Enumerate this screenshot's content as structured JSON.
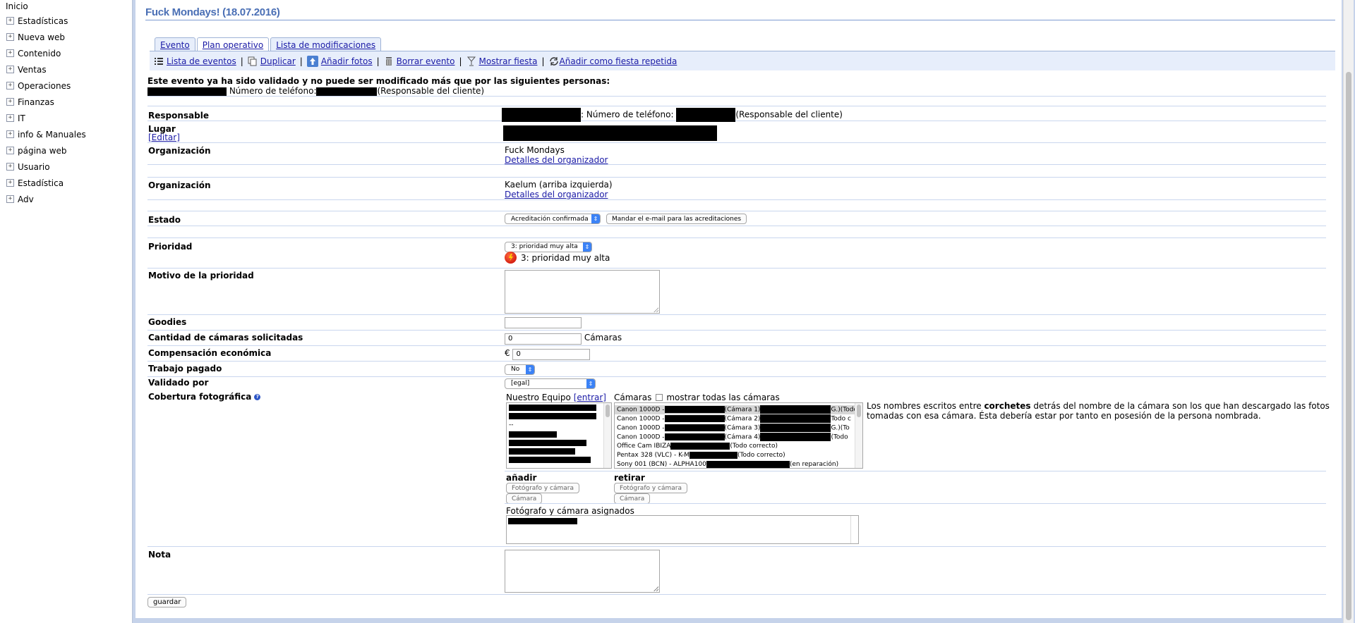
{
  "sidebar": {
    "home": "Inicio",
    "items": [
      "Estadísticas",
      "Nueva web",
      "Contenido",
      "Ventas",
      "Operaciones",
      "Finanzas",
      "IT",
      "info & Manuales",
      "página web",
      "Usuario",
      "Estadística",
      "Adv"
    ],
    "expander": "+"
  },
  "page": {
    "title": "Fuck Mondays! (18.07.2016)"
  },
  "tabs": [
    "Evento",
    "Plan operativo",
    "Lista de modificaciones"
  ],
  "actions": {
    "list": "Lista de eventos",
    "duplicate": "Duplicar",
    "add_photos": "Añadir fotos",
    "delete": "Borrar evento",
    "show": "Mostrar fiesta",
    "repeat": "Añadir como fiesta repetida",
    "separator": "|"
  },
  "notice": {
    "line1": "Este evento ya ha sido validado y no puede ser modificado más que por las siguientes personas:",
    "phone_label": "Número de teléfono:",
    "role": "(Responsable del cliente)"
  },
  "form": {
    "responsable": {
      "label": "Responsable",
      "phone_label": ": Número de teléfono:",
      "role": "(Responsable del cliente)"
    },
    "lugar": {
      "label": "Lugar",
      "edit": "[Editar]"
    },
    "org1": {
      "label": "Organización",
      "name": "Fuck Mondays",
      "link": "Detalles del organizador"
    },
    "org2": {
      "label": "Organización",
      "name": "Kaelum (arriba izquierda)",
      "link": "Detalles del organizador"
    },
    "estado": {
      "label": "Estado",
      "value": "Acreditación confirmada",
      "button": "Mandar el e-mail para las acreditaciones"
    },
    "prioridad": {
      "label": "Prioridad",
      "value": "3: prioridad muy alta",
      "display": "3: prioridad muy alta"
    },
    "motivo": {
      "label": "Motivo de la prioridad"
    },
    "goodies": {
      "label": "Goodies",
      "value": ""
    },
    "camaras": {
      "label": "Cantidad de cámaras solicitadas",
      "value": "0",
      "unit": "Cámaras"
    },
    "compensacion": {
      "label": "Compensación económica",
      "currency": "€",
      "value": "0"
    },
    "trabajo": {
      "label": "Trabajo pagado",
      "value": "No"
    },
    "validado": {
      "label": "Validado por",
      "value": "[egal]"
    },
    "cobertura": {
      "label": "Cobertura fotográfica",
      "team_label": "Nuestro Equipo",
      "team_link": "[entrar]",
      "team_dash": "--",
      "cams_label": "Cámaras",
      "show_all": "mostrar todas las cámaras",
      "cameras": [
        {
          "prefix": "Canon 1000D -",
          "mid": "(Cámara 1)",
          "suffix": "G.)(Todo c"
        },
        {
          "prefix": "Canon 1000D -",
          "mid": "(Cámara 2)",
          "suffix": "Todo c"
        },
        {
          "prefix": "Canon 1000D -",
          "mid": "(Cámara 3)",
          "suffix": "G.)(To"
        },
        {
          "prefix": "Canon 1000D -",
          "mid": "(Cámara 4)",
          "suffix": "(Todo"
        },
        {
          "prefix": "Office Cam IBIZA",
          "mid": "",
          "suffix": "(Todo correcto)"
        },
        {
          "prefix": "Pentax 328 (VLC) - K-M",
          "mid": "",
          "suffix": "(Todo correcto)"
        },
        {
          "prefix": "Sony 001 (BCN) - ALPHA100",
          "mid": "",
          "suffix": "(en reparación)"
        }
      ],
      "help": "Los nombres escritos entre ",
      "help_bold": "corchetes",
      "help_rest": " detrás del nombre de la cámara son los que han descargado las fotos tomadas con esa cámara. Ésta debería estar por tanto en posesión de la persona nombrada.",
      "add_label": "añadir",
      "remove_label": "retirar",
      "btn_photographer_camera": "Fotógrafo y cámara",
      "btn_camera": "Cámara",
      "assigned_label": "Fotógrafo y cámara asignados"
    },
    "nota": {
      "label": "Nota"
    },
    "save": "guardar"
  }
}
